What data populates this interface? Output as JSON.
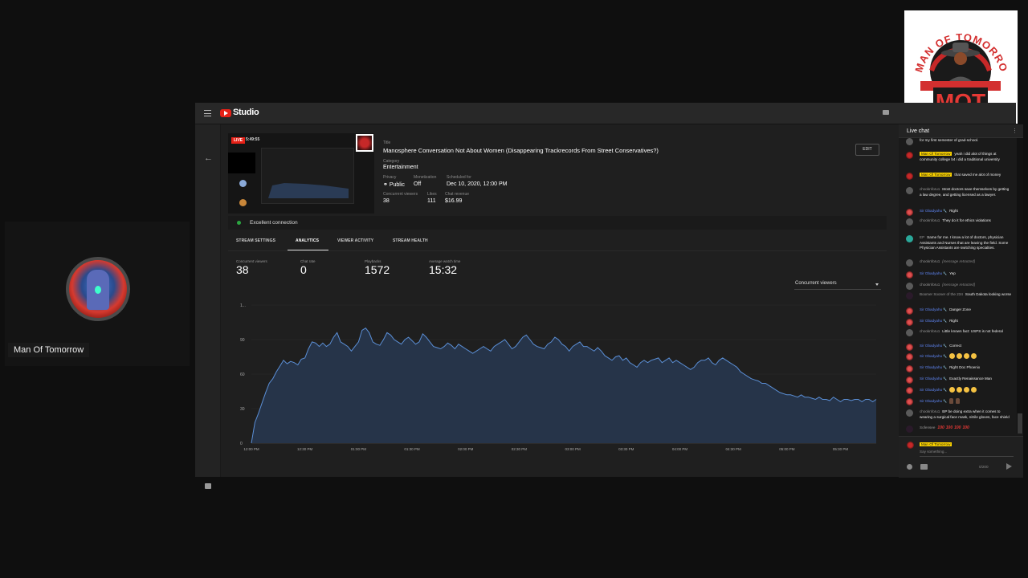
{
  "guest": {
    "name": "Man Of Tomorrow"
  },
  "logo": {
    "arc_text": "MAN OF TOMORROW",
    "initials": "MOT"
  },
  "studio": {
    "app_name": "Studio",
    "stream": {
      "live_badge": "LIVE",
      "live_timer": "5:49:55",
      "title_label": "Title",
      "title": "Manosphere Conversation Not About Women (Disappearing Trackrecords From Street Conservatives?)",
      "category_label": "Category",
      "category": "Entertainment",
      "privacy_label": "Privacy",
      "privacy": "Public",
      "privacy_icon": "globe-icon",
      "monetization_label": "Monetization",
      "monetization": "Off",
      "scheduled_label": "Scheduled for",
      "scheduled": "Dec 10, 2020, 12:00 PM",
      "concurrent_label": "Concurrent viewers",
      "concurrent": "38",
      "likes_label": "Likes",
      "likes": "111",
      "revenue_label": "Chat revenue",
      "revenue": "$16.99",
      "edit_label": "EDIT"
    },
    "connection": {
      "status": "Excellent connection",
      "color": "#2ba640"
    },
    "tabs": [
      {
        "label": "STREAM SETTINGS",
        "active": false
      },
      {
        "label": "ANALYTICS",
        "active": true
      },
      {
        "label": "VIEWER ACTIVITY",
        "active": false
      },
      {
        "label": "STREAM HEALTH",
        "active": false
      }
    ],
    "metrics": [
      {
        "label": "Concurrent viewers",
        "value": "38"
      },
      {
        "label": "Chat rate",
        "value": "0"
      },
      {
        "label": "Playbacks",
        "value": "1572"
      },
      {
        "label": "Average watch time",
        "value": "15:32"
      }
    ],
    "metric_dropdown": {
      "selected": "Concurrent viewers"
    }
  },
  "chart_data": {
    "type": "area",
    "title": "",
    "xlabel": "",
    "ylabel": "Concurrent viewers",
    "ylim": [
      0,
      120
    ],
    "yticks": [
      0,
      30,
      60,
      90,
      120
    ],
    "ytick_labels": [
      "0",
      "30",
      "60",
      "90",
      "1..."
    ],
    "xticks": [
      "12:00 PM",
      "12:30 PM",
      "01:00 PM",
      "01:30 PM",
      "02:00 PM",
      "02:30 PM",
      "03:00 PM",
      "03:30 PM",
      "04:00 PM",
      "04:30 PM",
      "05:00 PM",
      "05:30 PM"
    ],
    "grid": true,
    "line_color": "#5b8fd6",
    "fill_color": "#263449",
    "x_minutes": [
      0,
      2,
      4,
      6,
      8,
      10,
      12,
      14,
      16,
      18,
      20,
      22,
      24,
      26,
      28,
      30,
      32,
      34,
      36,
      38,
      40,
      42,
      44,
      46,
      48,
      50,
      52,
      54,
      56,
      58,
      60,
      62,
      64,
      66,
      68,
      70,
      72,
      74,
      76,
      78,
      80,
      82,
      84,
      86,
      88,
      90,
      92,
      94,
      96,
      98,
      100,
      102,
      104,
      106,
      108,
      110,
      112,
      114,
      116,
      118,
      120,
      122,
      124,
      126,
      128,
      130,
      132,
      134,
      136,
      138,
      140,
      142,
      144,
      146,
      148,
      150,
      152,
      154,
      156,
      158,
      160,
      162,
      164,
      166,
      168,
      170,
      172,
      174,
      176,
      178,
      180,
      182,
      184,
      186,
      188,
      190,
      192,
      194,
      196,
      198,
      200,
      202,
      204,
      206,
      208,
      210,
      212,
      214,
      216,
      218,
      220,
      222,
      224,
      226,
      228,
      230,
      232,
      234,
      236,
      238,
      240,
      242,
      244,
      246,
      248,
      250,
      252,
      254,
      256,
      258,
      260,
      262,
      264,
      266,
      268,
      270,
      272,
      274,
      276,
      278,
      280,
      282,
      284,
      286,
      288,
      290,
      292,
      294,
      296,
      298,
      300,
      302,
      304,
      306,
      308,
      310,
      312,
      314,
      316,
      318,
      320,
      322,
      324,
      326,
      328,
      330,
      332,
      334,
      336,
      338,
      340,
      342,
      344,
      346,
      348,
      350
    ],
    "series": [
      {
        "name": "Concurrent viewers",
        "values": [
          0,
          18,
          26,
          35,
          44,
          52,
          56,
          62,
          67,
          72,
          69,
          71,
          70,
          68,
          73,
          74,
          82,
          88,
          87,
          84,
          87,
          84,
          86,
          92,
          96,
          88,
          86,
          84,
          80,
          84,
          88,
          98,
          100,
          96,
          88,
          86,
          85,
          90,
          96,
          94,
          90,
          88,
          86,
          90,
          92,
          89,
          86,
          88,
          95,
          92,
          88,
          84,
          83,
          82,
          84,
          87,
          85,
          82,
          86,
          84,
          82,
          80,
          78,
          80,
          82,
          84,
          82,
          80,
          84,
          86,
          88,
          90,
          86,
          82,
          84,
          88,
          92,
          94,
          90,
          86,
          84,
          83,
          82,
          86,
          88,
          92,
          90,
          86,
          84,
          80,
          84,
          86,
          88,
          84,
          84,
          82,
          80,
          83,
          80,
          76,
          74,
          72,
          75,
          76,
          72,
          74,
          70,
          68,
          66,
          70,
          72,
          70,
          72,
          73,
          74,
          70,
          72,
          74,
          70,
          72,
          70,
          68,
          66,
          64,
          66,
          70,
          72,
          72,
          74,
          70,
          68,
          72,
          74,
          72,
          70,
          68,
          66,
          62,
          60,
          58,
          56,
          55,
          54,
          52,
          52,
          50,
          48,
          46,
          44,
          43,
          42,
          42,
          41,
          40,
          42,
          40,
          40,
          39,
          38,
          40,
          38,
          38,
          37,
          40,
          38,
          36,
          38,
          38,
          37,
          38,
          38,
          36,
          38,
          38,
          36,
          38
        ]
      }
    ]
  },
  "chat": {
    "title": "Live chat",
    "messages": [
      {
        "author": "",
        "role": "viewer",
        "avatar": "grey",
        "text": "for my first semester of grad-school."
      },
      {
        "author": "Man Of Tomorrow",
        "role": "owner",
        "avatar": "owner",
        "text": "yeah i did alot of things at community college b4 i did a traditional university"
      },
      {
        "author": "Man Of Tomorrow",
        "role": "owner",
        "avatar": "owner",
        "text": "that saved me alot of money"
      },
      {
        "author": "chooknforu1",
        "role": "viewer",
        "avatar": "grey",
        "text": "Most doctors save themselves by getting a law degree, and getting licensed as a lawyer."
      },
      {
        "author": "Sir Obadyahu",
        "role": "mod",
        "avatar": "red",
        "text": "Right"
      },
      {
        "author": "chooknforu1",
        "role": "viewer",
        "avatar": "grey",
        "text": "They do it for ethics violations"
      },
      {
        "author": "EP",
        "role": "viewer",
        "avatar": "teal",
        "text": "Same for me. I know a lot of doctors, physician Assistants and Nurses that are leaving the field. Some Physician Assistants are switching specialties."
      },
      {
        "author": "chooknforu1",
        "role": "viewer",
        "avatar": "grey",
        "text": "[message retracted]",
        "retracted": true
      },
      {
        "author": "Sir Obadyahu",
        "role": "mod",
        "avatar": "red",
        "text": "Yep"
      },
      {
        "author": "chooknforu1",
        "role": "viewer",
        "avatar": "grey",
        "text": "[message retracted]",
        "retracted": true
      },
      {
        "author": "Boomer Sooner of the 234",
        "role": "viewer",
        "avatar": "dark",
        "text": "South Dakota looking worse"
      },
      {
        "author": "Sir Obadyahu",
        "role": "mod",
        "avatar": "red",
        "text": "Danger Zone"
      },
      {
        "author": "Sir Obadyahu",
        "role": "mod",
        "avatar": "red",
        "text": "Right"
      },
      {
        "author": "chooknforu1",
        "role": "viewer",
        "avatar": "grey",
        "text": "Little known fact: USPS is not federal"
      },
      {
        "author": "Sir Obadyahu",
        "role": "mod",
        "avatar": "red",
        "text": "Correct"
      },
      {
        "author": "Sir Obadyahu",
        "role": "mod",
        "avatar": "red",
        "text": "",
        "emojis": [
          "rofl",
          "crying",
          "crying",
          "crying"
        ]
      },
      {
        "author": "Sir Obadyahu",
        "role": "mod",
        "avatar": "red",
        "text": "Right Doc Phoenix"
      },
      {
        "author": "Sir Obadyahu",
        "role": "mod",
        "avatar": "red",
        "text": "Exactly Renaissance Man"
      },
      {
        "author": "Sir Obadyahu",
        "role": "mod",
        "avatar": "red",
        "text": "",
        "emojis": [
          "rofl",
          "crying",
          "crying",
          "crying"
        ]
      },
      {
        "author": "Sir Obadyahu",
        "role": "mod",
        "avatar": "red",
        "text": "",
        "emojis": [
          "victory-hand",
          "victory-hand"
        ]
      },
      {
        "author": "chooknforu1",
        "role": "viewer",
        "avatar": "grey",
        "text": "BP be doing extra when it comes to wearing a surgical face mask, nitrile gloves, face shield"
      },
      {
        "author": "Sofensee",
        "role": "viewer",
        "avatar": "dark",
        "text": "",
        "emojis": [
          "hundred",
          "hundred",
          "hundred",
          "hundred"
        ]
      }
    ],
    "input": {
      "author": "Man Of Tomorrow",
      "placeholder": "Say something...",
      "counter": "0/200"
    }
  }
}
